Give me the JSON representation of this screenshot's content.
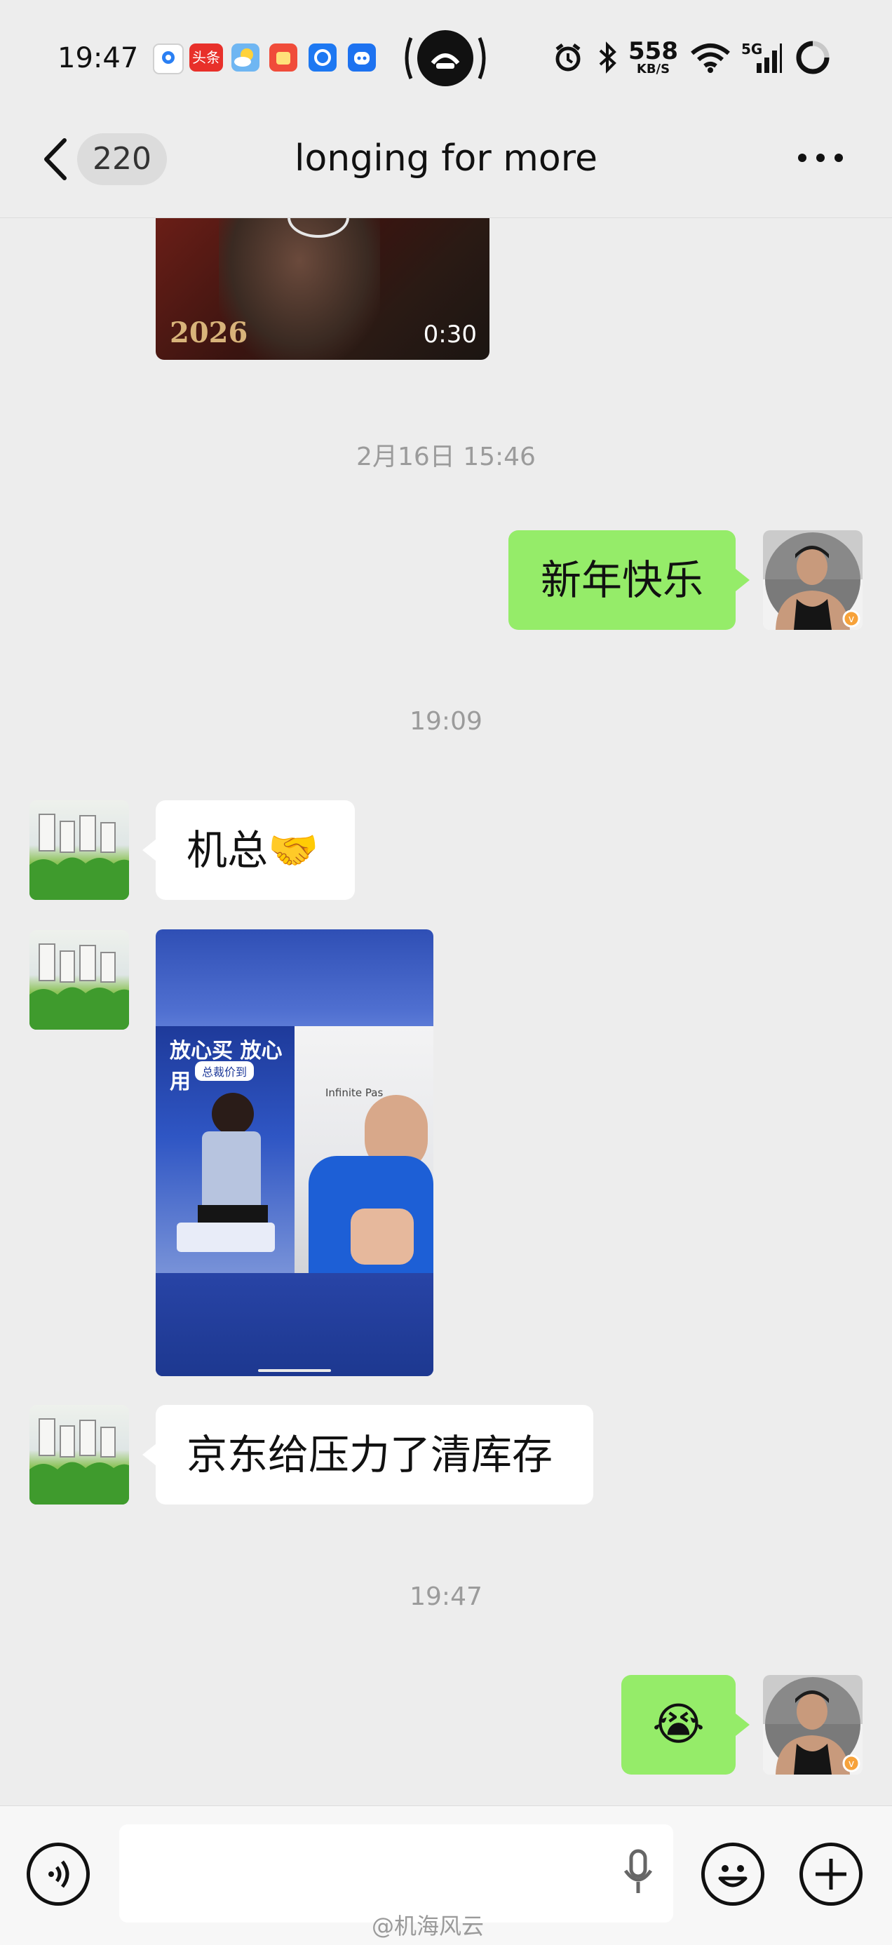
{
  "status_bar": {
    "time": "19:47",
    "network_speed_value": "558",
    "network_speed_unit": "KB/S",
    "cellular": "5G",
    "app_icons": [
      "location-icon",
      "toutiao-icon",
      "weather-icon",
      "game-icon",
      "browser-icon",
      "assistant-icon"
    ],
    "toutiao_label": "头条"
  },
  "nav": {
    "unread_count": "220",
    "title": "longing for more"
  },
  "messages": {
    "video_duration": "0:30",
    "video_overlay_year": "2026",
    "timestamp_1": "2月16日 15:46",
    "msg_1": "新年快乐",
    "timestamp_2": "19:09",
    "msg_2_text": "机总",
    "msg_2_emoji": "🤝",
    "msg_3_image_banner": "放心买 放心用",
    "msg_3_image_sub": "总裁价到",
    "msg_3_image_store": "Infinite Pas",
    "msg_4": "京东给压力了清库存",
    "timestamp_3": "19:47",
    "msg_5_emoji": "😭"
  },
  "input_bar": {
    "watermark": "@机海风云"
  },
  "colors": {
    "background": "#ededed",
    "green_bubble": "#95ec69",
    "white_bubble": "#ffffff",
    "timestamp_text": "#9b9b9b"
  }
}
